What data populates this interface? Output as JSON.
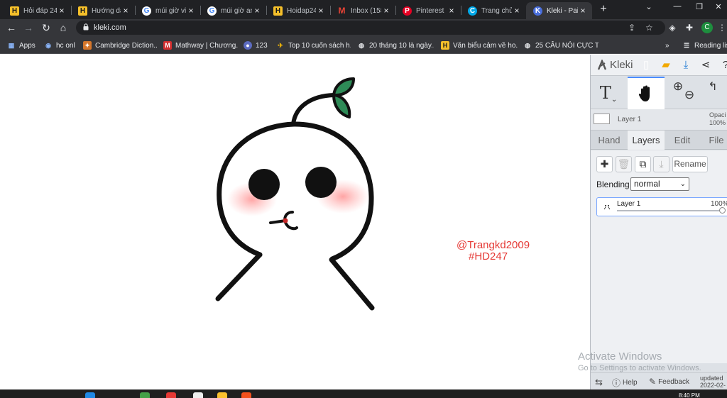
{
  "browser": {
    "tabs": [
      {
        "label": "Hỏi đáp 24",
        "icon": "hoidap-icon",
        "glyph": "H"
      },
      {
        "label": "Hướng dẫ",
        "icon": "hoidap-icon",
        "glyph": "H"
      },
      {
        "label": "múi giờ vi",
        "icon": "google-icon",
        "glyph": "G"
      },
      {
        "label": "múi giờ an",
        "icon": "google-icon",
        "glyph": "G"
      },
      {
        "label": "Hoidap24",
        "icon": "hoidap-icon",
        "glyph": "H"
      },
      {
        "label": "Inbox (158",
        "icon": "gmail-icon",
        "glyph": "M"
      },
      {
        "label": "Pinterest",
        "icon": "pinterest-icon",
        "glyph": "P"
      },
      {
        "label": "Trang chủ",
        "icon": "canva-icon",
        "glyph": "C"
      },
      {
        "label": "Kleki - Pai",
        "icon": "kleki-icon",
        "glyph": "K",
        "active": true
      }
    ],
    "new_tab_label": "+",
    "url": "kleki.com",
    "profile_initial": "C",
    "bookmarks": [
      {
        "label": "Apps",
        "icon": "apps-grid-icon"
      },
      {
        "label": "hc onl",
        "icon": "globe-icon"
      },
      {
        "label": "Cambridge Diction...",
        "icon": "cambridge-icon"
      },
      {
        "label": "Mathway | Chương...",
        "icon": "mathway-icon"
      },
      {
        "label": "123",
        "icon": "bookmark-icon"
      },
      {
        "label": "Top 10 cuốn sách h...",
        "icon": "bird-icon"
      },
      {
        "label": "20 tháng 10 là ngày...",
        "icon": "globe-icon"
      },
      {
        "label": "Văn biểu cảm về ho...",
        "icon": "hoidap-icon"
      },
      {
        "label": "25 CÂU NÓI CỰC T...",
        "icon": "globe-icon"
      }
    ],
    "bookmarks_overflow": "»",
    "reading_list": "Reading list"
  },
  "canvas": {
    "watermark_line1": "@Trangkd2009",
    "watermark_line2": "#HD247"
  },
  "kleki": {
    "logo": "Kleki",
    "layer_preview_name": "Layer 1",
    "opacity_label": "Opaci",
    "opacity_value": "100%",
    "tabs": [
      "Hand",
      "Layers",
      "Edit",
      "File"
    ],
    "active_tab": "Layers",
    "rename_label": "Rename",
    "blending_label": "Blending",
    "blending_value": "normal",
    "layer": {
      "name": "Layer 1",
      "opacity": "100%"
    },
    "help_label": "Help",
    "feedback_label": "Feedback",
    "updated_label": "updated",
    "updated_date": "2022-02-"
  },
  "system": {
    "activate_title": "Activate Windows",
    "activate_sub": "Go to Settings to activate Windows.",
    "clock": "8:40 PM"
  },
  "colors": {
    "accent": "#4a8cff",
    "watermark": "#e53935",
    "chrome_dark": "#202124"
  }
}
